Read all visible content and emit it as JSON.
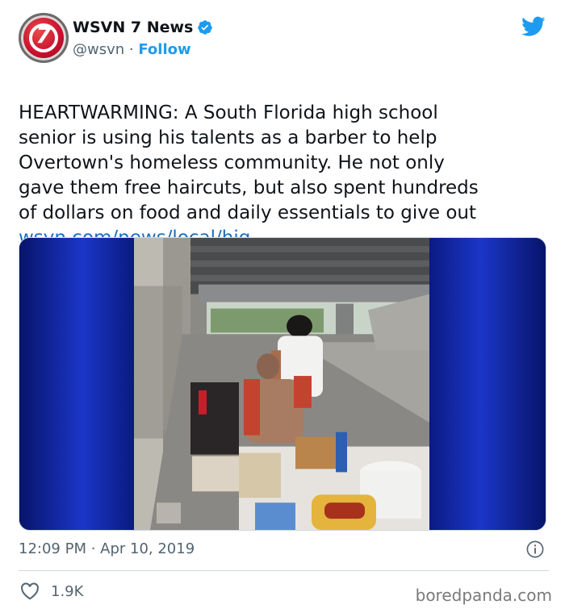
{
  "account": {
    "display_name": "WSVN 7 News",
    "handle": "@wsvn",
    "separator": " · ",
    "follow_label": "Follow",
    "avatar_text": "7"
  },
  "tweet": {
    "text": "HEARTWARMING: A South Florida high school\nsenior is using his talents as a barber to help\nOvertown's homeless community. He not only\ngave them free haircuts, but also spent hundreds\nof dollars on food and daily essentials to give out",
    "link": "wsvn.com/news/local/hig..."
  },
  "meta": {
    "time": "12:09 PM · Apr 10, 2019"
  },
  "engagement": {
    "likes": "1.9K"
  },
  "watermark": "boredpanda.com",
  "colors": {
    "accent": "#1d9bf0",
    "link": "#1b6ec2",
    "text": "#0f1419",
    "muted": "#536471",
    "media_blue": "#1b36c8"
  },
  "icons": [
    "verified-badge-icon",
    "twitter-bird-icon",
    "info-icon",
    "heart-icon"
  ]
}
